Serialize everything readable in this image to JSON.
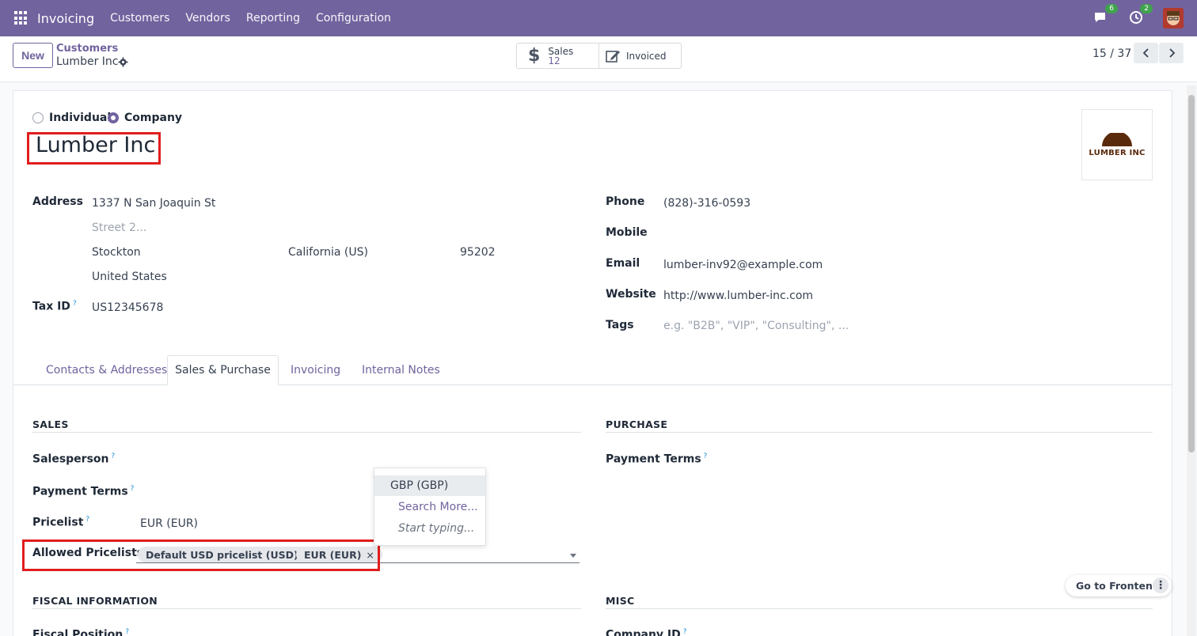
{
  "topbar": {
    "app_name": "Invoicing",
    "menu": [
      "Customers",
      "Vendors",
      "Reporting",
      "Configuration"
    ],
    "messages_count": "6",
    "activities_count": "2",
    "bg_color": "#71639e"
  },
  "control": {
    "new_label": "New",
    "breadcrumb_parent": "Customers",
    "breadcrumb_current": "Lumber Inc",
    "sales_label": "Sales",
    "sales_value": "12",
    "invoiced_label": "Invoiced",
    "pager": "15 / 37"
  },
  "form": {
    "type_individual": "Individual",
    "type_company": "Company",
    "name": "Lumber Inc",
    "logo_text": "LUMBER INC",
    "address_label": "Address",
    "street": "1337 N San Joaquin St",
    "street2_placeholder": "Street 2...",
    "city": "Stockton",
    "state": "California (US)",
    "zip": "95202",
    "country": "United States",
    "tax_id_label": "Tax ID",
    "tax_id": "US12345678",
    "phone_label": "Phone",
    "phone": "(828)-316-0593",
    "mobile_label": "Mobile",
    "email_label": "Email",
    "email": "lumber-inv92@example.com",
    "website_label": "Website",
    "website": "http://www.lumber-inc.com",
    "tags_label": "Tags",
    "tags_placeholder": "e.g. \"B2B\", \"VIP\", \"Consulting\", ..."
  },
  "tabs": [
    "Contacts & Addresses",
    "Sales & Purchase",
    "Invoicing",
    "Internal Notes"
  ],
  "sales": {
    "section": "SALES",
    "salesperson_label": "Salesperson",
    "payment_terms_label": "Payment Terms",
    "pricelist_label": "Pricelist",
    "pricelist_value": "EUR (EUR)",
    "allowed_pricelists_label": "Allowed Pricelists",
    "allowed_tags": [
      "Default USD pricelist (USD)",
      "EUR (EUR)"
    ]
  },
  "purchase": {
    "section": "PURCHASE",
    "payment_terms_label": "Payment Terms"
  },
  "dropdown": {
    "option": "GBP (GBP)",
    "search_more": "Search More...",
    "hint": "Start typing..."
  },
  "fiscal": {
    "section": "FISCAL INFORMATION",
    "fiscal_position_label": "Fiscal Position"
  },
  "misc": {
    "section": "MISC",
    "company_id_label": "Company ID"
  },
  "frontend_button": "Go to Frontend",
  "help_mark": "?",
  "remove_mark": "×"
}
